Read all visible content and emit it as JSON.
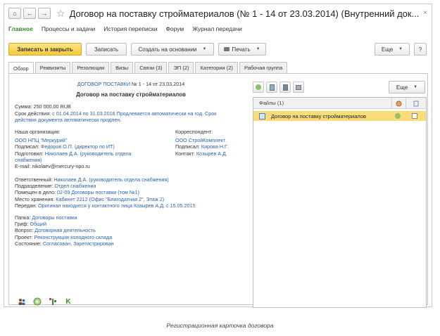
{
  "window": {
    "title": "Договор на поставку стройматериалов (№ 1 - 14 от 23.03.2014) (Внутренний док...",
    "close": "×",
    "nav": {
      "home": "⌂",
      "back": "←",
      "forward": "→"
    },
    "star": "☆"
  },
  "menu": [
    "Главное",
    "Процессы и задачи",
    "История переписки",
    "Форум",
    "Журнал передачи"
  ],
  "toolbar": {
    "save_close": "Записать и закрыть",
    "save": "Записать",
    "create_based": "Создать на основании",
    "print": "Печать",
    "more": "Еще",
    "help": "?"
  },
  "tabs": [
    "Обзор",
    "Реквизиты",
    "Резолюции",
    "Визы",
    "Связи (3)",
    "ЭП (2)",
    "Категории (2)",
    "Рабочая группа"
  ],
  "doc": {
    "header_link": "ДОГОВОР ПОСТАВКИ",
    "header_rest": " № 1 - 14 от 23.03.2014",
    "subject": "Договор на поставку стройматериалов",
    "sum_label": "Сумма: ",
    "sum_value": "250 000,00 RUB",
    "term_label": "Срок действия: ",
    "term_value_1": "с 01.04.2014 по 31.03.2016 Продлевается автоматически на год. Срок",
    "term_value_2": "действия документа автоматически продлен.",
    "org_label": "Наша организация:",
    "org_name": "ООО НПЦ \"Меркурий\"",
    "signed_label": "Подписал: ",
    "signed_value": "Федоров О.П. (директор по ИТ)",
    "prepared_label": "Подготовил: ",
    "prepared_value_1": "Николаев Д.А. (руководитель отдела",
    "prepared_value_2": "снабжения)",
    "email": "E-mail: nikolaev@mercury-npo.ru",
    "corr_label": "Корреспондент:",
    "corr_name": "ООО СтройКомплект",
    "corr_signed_label": "Подписал: ",
    "corr_signed_value": "Кирова Н.Г.",
    "corr_contact_label": "Контакт: ",
    "corr_contact_value": "Козырев А.Д.",
    "resp_label": "Ответственный: ",
    "resp_value": "Николаев Д.А. (руководитель отдела снабжения)",
    "dept_label": "Подразделение: ",
    "dept_value": "Отдел снабжения",
    "case_label": "Помещен в дело: ",
    "case_value": "02-09 Договоры поставки (том №1)",
    "storage_label": "Место хранения: ",
    "storage_value": "Кабинет 2212 (Офис \"Благодатная 2\", Этаж 2)",
    "passed_label": "Передан: ",
    "passed_value": "Оригинал находится у контактного лица Козырев А.Д. с 15.05.2015",
    "folder_label": "Папка: ",
    "folder_value": "Договоры поставки",
    "grif_label": "Гриф: ",
    "grif_value": "Общий",
    "question_label": "Вопрос: ",
    "question_value": "Договорная деятельность",
    "project_label": "Проект: ",
    "project_value": "Реконструкция холодного склада",
    "state_label": "Состояние: ",
    "state_value": "Согласован, Зарегистрирован"
  },
  "files": {
    "more": "Еще",
    "header": "Файлы (1)",
    "rows": [
      {
        "name": "Договор на поставку стройматериалов"
      }
    ]
  },
  "bottom_icons": {
    "k": "K"
  },
  "caption": "Регистрационная карточка договора",
  "colors": {
    "accent_green": "#3d8a2f",
    "link_blue": "#2a63b2",
    "primary_yellow": "#f5c93a",
    "row_highlight": "#f9dc7a"
  }
}
